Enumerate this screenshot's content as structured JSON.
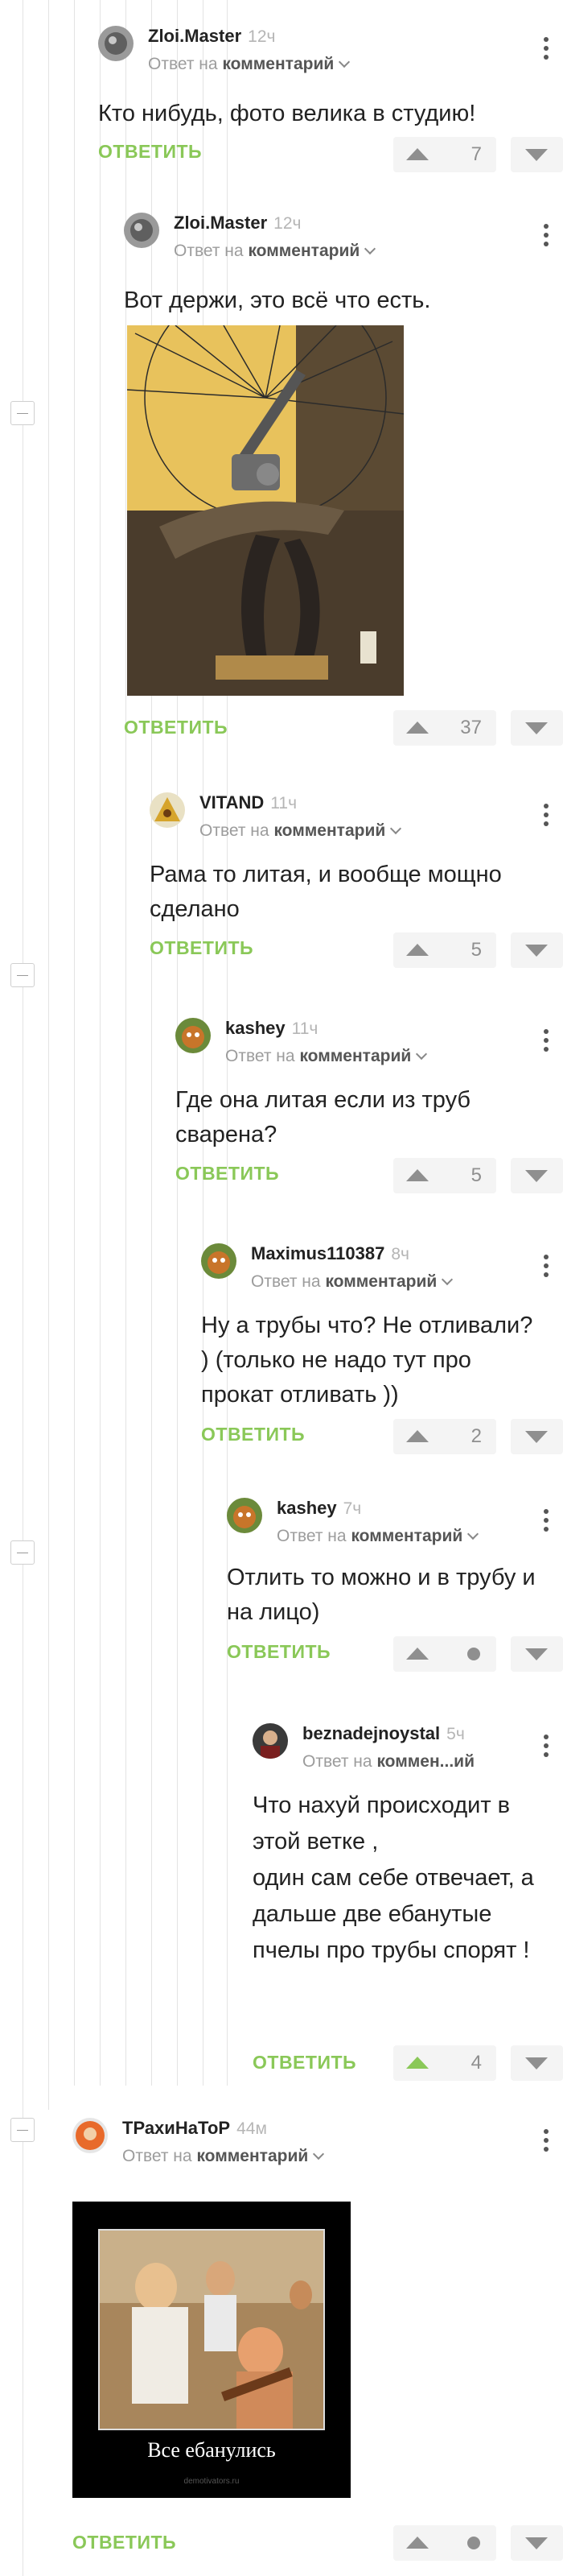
{
  "labels": {
    "reply_to": "Ответ на",
    "comment": "комментарий",
    "reply": "ОТВЕТИТЬ"
  },
  "comments": [
    {
      "author": "Zloi.Master",
      "time": "12ч",
      "target": "комментарий",
      "text": "Кто нибудь, фото велика в студию!",
      "rating": "7",
      "voted_up": false
    },
    {
      "author": "Zloi.Master",
      "time": "12ч",
      "target": "комментарий",
      "text": "Вот держи, это всё что есть.",
      "rating": "37",
      "voted_up": false
    },
    {
      "author": "VITAND",
      "time": "11ч",
      "target": "комментарий",
      "text": "Рама то литая, и вообще мощно сделано",
      "rating": "5",
      "voted_up": false
    },
    {
      "author": "kashey",
      "time": "11ч",
      "target": "комментарий",
      "text": "Где она литая если из труб сварена?",
      "rating": "5",
      "voted_up": false
    },
    {
      "author": "Maximus110387",
      "time": "8ч",
      "target": "комментарий",
      "text": "Ну а трубы что? Не отливали? ) (только не надо тут про прокат отливать ))",
      "rating": "2",
      "voted_up": false
    },
    {
      "author": "kashey",
      "time": "7ч",
      "target": "комментарий",
      "text": "Отлить то можно и в трубу и на лицо)",
      "rating": "",
      "voted_up": false
    },
    {
      "author": "beznadejnoystal",
      "time": "5ч",
      "target": "коммен...ий",
      "text": "Что нахуй происходит в этой ветке ,\nодин сам себе отвечает, а дальше две ебанутые пчелы про трубы спорят !",
      "rating": "4",
      "voted_up": true
    },
    {
      "author": "ТРахиНаТоР",
      "time": "44м",
      "target": "комментарий",
      "text": "",
      "rating": "",
      "voted_up": false
    }
  ],
  "images": {
    "bike_photo": "photo: sculpted bicycle with wooden seat",
    "demotivator_caption": "Все ебанулись",
    "demotivator_site": "demotivators.ru"
  },
  "colors": {
    "accent": "#8ac858",
    "muted": "#8f8f8f"
  }
}
